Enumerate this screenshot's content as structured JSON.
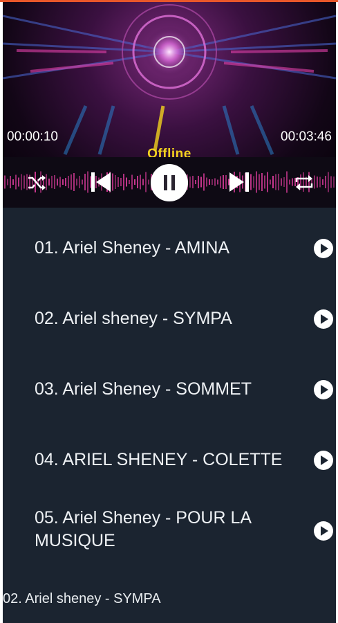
{
  "player": {
    "elapsed": "00:00:10",
    "duration": "00:03:46",
    "status": "Offline",
    "state": "playing"
  },
  "controls": {
    "shuffle_icon": "shuffle-icon",
    "previous_icon": "skip-previous-icon",
    "pause_icon": "pause-icon",
    "next_icon": "skip-next-icon",
    "repeat_icon": "repeat-icon"
  },
  "playlist": [
    {
      "title": "01. Ariel Sheney - AMINA"
    },
    {
      "title": "02. Ariel sheney -  SYMPA"
    },
    {
      "title": "03. Ariel Sheney - SOMMET"
    },
    {
      "title": "04. ARIEL SHENEY  - COLETTE"
    },
    {
      "title": "05. Ariel Sheney - POUR LA MUSIQUE"
    }
  ],
  "now_playing": "02. Ariel sheney -  SYMPA",
  "colors": {
    "background": "#1b2430",
    "accent": "#e8572a",
    "status": "#f2d21e",
    "visualizer": "#c9378f"
  }
}
